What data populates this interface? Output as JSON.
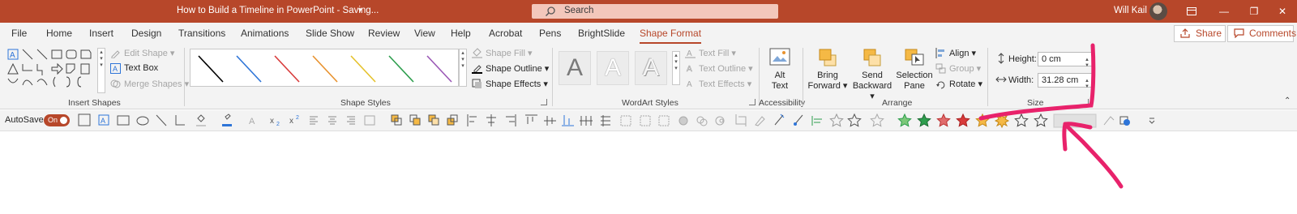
{
  "titlebar": {
    "title": "How to Build a Timeline in PowerPoint - Saving...",
    "search_placeholder": "Search",
    "user": "Will Kail"
  },
  "tabs": [
    "File",
    "Home",
    "Insert",
    "Design",
    "Transitions",
    "Animations",
    "Slide Show",
    "Review",
    "View",
    "Help",
    "Acrobat",
    "Pens",
    "BrightSlide",
    "Shape Format"
  ],
  "active_tab": "Shape Format",
  "share_label": "Share",
  "comments_label": "Comments",
  "ribbon": {
    "insert_shapes": {
      "label": "Insert Shapes",
      "edit_shape": "Edit Shape",
      "text_box": "Text Box",
      "merge_shapes": "Merge Shapes"
    },
    "shape_styles": {
      "label": "Shape Styles",
      "fill": "Shape Fill",
      "outline": "Shape Outline",
      "effects": "Shape Effects",
      "line_colors": [
        "#000000",
        "#2e75d8",
        "#d83b3b",
        "#e8922e",
        "#e5c22c",
        "#2e9e4e",
        "#9b59b6"
      ]
    },
    "wordart": {
      "label": "WordArt Styles",
      "letter": "A",
      "text_fill": "Text Fill",
      "text_outline": "Text Outline",
      "text_effects": "Text Effects"
    },
    "accessibility": {
      "label": "Accessibility",
      "alt_text_1": "Alt",
      "alt_text_2": "Text"
    },
    "arrange": {
      "label": "Arrange",
      "bring_forward_1": "Bring",
      "bring_forward_2": "Forward",
      "send_backward_1": "Send",
      "send_backward_2": "Backward",
      "selection_pane_1": "Selection",
      "selection_pane_2": "Pane",
      "align": "Align",
      "group": "Group",
      "rotate": "Rotate"
    },
    "size": {
      "label": "Size",
      "height_label": "Height:",
      "height_value": "0 cm",
      "width_label": "Width:",
      "width_value": "31.28 cm"
    }
  },
  "qat": {
    "autosave_label": "AutoSave",
    "autosave_state": "On"
  },
  "colors": {
    "accent": "#b7472a",
    "annotation": "#e8226b"
  }
}
